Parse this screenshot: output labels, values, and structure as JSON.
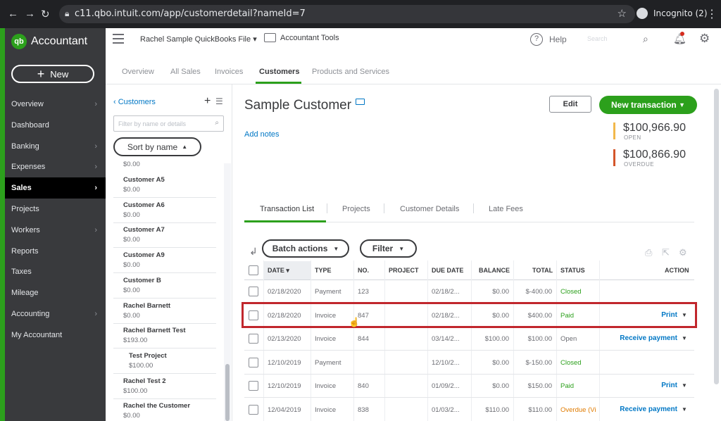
{
  "browser": {
    "url": "c11.qbo.intuit.com/app/customerdetail?nameId=7",
    "incognito_label": "Incognito (2)"
  },
  "leftnav": {
    "brand": "Accountant",
    "logo_text": "qb",
    "new_label": "New",
    "items": [
      {
        "label": "Overview",
        "chevron": true
      },
      {
        "label": "Dashboard",
        "chevron": false
      },
      {
        "label": "Banking",
        "chevron": true
      },
      {
        "label": "Expenses",
        "chevron": true
      },
      {
        "label": "Sales",
        "chevron": true,
        "active": true
      },
      {
        "label": "Projects",
        "chevron": false
      },
      {
        "label": "Workers",
        "chevron": true
      },
      {
        "label": "Reports",
        "chevron": false
      },
      {
        "label": "Taxes",
        "chevron": false
      },
      {
        "label": "Mileage",
        "chevron": false
      },
      {
        "label": "Accounting",
        "chevron": true
      },
      {
        "label": "My Accountant",
        "chevron": false
      }
    ]
  },
  "topbar": {
    "company": "Rachel Sample QuickBooks File",
    "accountant_tools": "Accountant Tools",
    "help": "Help",
    "search_placeholder": "Search"
  },
  "tabs": [
    "Overview",
    "All Sales",
    "Invoices",
    "Customers",
    "Products and Services"
  ],
  "list": {
    "back_label": "Customers",
    "filter_placeholder": "Filter by name or details",
    "sort_label": "Sort by name",
    "partial_balance": "$0.00",
    "customers": [
      {
        "name": "Customer A5",
        "balance": "$0.00"
      },
      {
        "name": "Customer A6",
        "balance": "$0.00"
      },
      {
        "name": "Customer A7",
        "balance": "$0.00"
      },
      {
        "name": "Customer A9",
        "balance": "$0.00"
      },
      {
        "name": "Customer B",
        "balance": "$0.00"
      },
      {
        "name": "Rachel Barnett",
        "balance": "$0.00"
      },
      {
        "name": "Rachel Barnett Test",
        "balance": "$193.00"
      },
      {
        "name": "Test Project",
        "balance": "$100.00",
        "sub": true
      },
      {
        "name": "Rachel Test 2",
        "balance": "$100.00"
      },
      {
        "name": "Rachel the Customer",
        "balance": "$0.00"
      }
    ]
  },
  "detail": {
    "title": "Sample Customer",
    "add_notes": "Add notes",
    "edit_label": "Edit",
    "new_transaction_label": "New transaction",
    "open_amount": "$100,966.90",
    "open_label": "OPEN",
    "overdue_amount": "$100,866.90",
    "overdue_label": "OVERDUE",
    "colors": {
      "open": "#f2b84b",
      "overdue": "#d4562a",
      "brand": "#2ca01c",
      "link": "#0077c5"
    },
    "tabs": [
      "Transaction List",
      "Projects",
      "Customer Details",
      "Late Fees"
    ],
    "batch_label": "Batch actions",
    "filter_label": "Filter"
  },
  "table": {
    "headers": [
      "DATE",
      "TYPE",
      "NO.",
      "PROJECT",
      "DUE DATE",
      "BALANCE",
      "TOTAL",
      "STATUS",
      "ACTION"
    ],
    "rows": [
      {
        "date": "02/18/2020",
        "type": "Payment",
        "no": "123",
        "project": "",
        "due": "02/18/2...",
        "balance": "$0.00",
        "total": "$-400.00",
        "status": "Closed",
        "status_color": "green",
        "action": ""
      },
      {
        "date": "02/18/2020",
        "type": "Invoice",
        "no": "847",
        "project": "",
        "due": "02/18/2...",
        "balance": "$0.00",
        "total": "$400.00",
        "status": "Paid",
        "status_color": "green",
        "action": "Print",
        "highlight": true
      },
      {
        "date": "02/13/2020",
        "type": "Invoice",
        "no": "844",
        "project": "",
        "due": "03/14/2...",
        "balance": "$100.00",
        "total": "$100.00",
        "status": "Open",
        "status_color": "gray",
        "action": "Receive payment"
      },
      {
        "date": "12/10/2019",
        "type": "Payment",
        "no": "",
        "project": "",
        "due": "12/10/2...",
        "balance": "$0.00",
        "total": "$-150.00",
        "status": "Closed",
        "status_color": "green",
        "action": ""
      },
      {
        "date": "12/10/2019",
        "type": "Invoice",
        "no": "840",
        "project": "",
        "due": "01/09/2...",
        "balance": "$0.00",
        "total": "$150.00",
        "status": "Paid",
        "status_color": "green",
        "action": "Print"
      },
      {
        "date": "12/04/2019",
        "type": "Invoice",
        "no": "838",
        "project": "",
        "due": "01/03/2...",
        "balance": "$110.00",
        "total": "$110.00",
        "status": "Overdue (Vi",
        "status_color": "orange",
        "action": "Receive payment"
      }
    ]
  }
}
